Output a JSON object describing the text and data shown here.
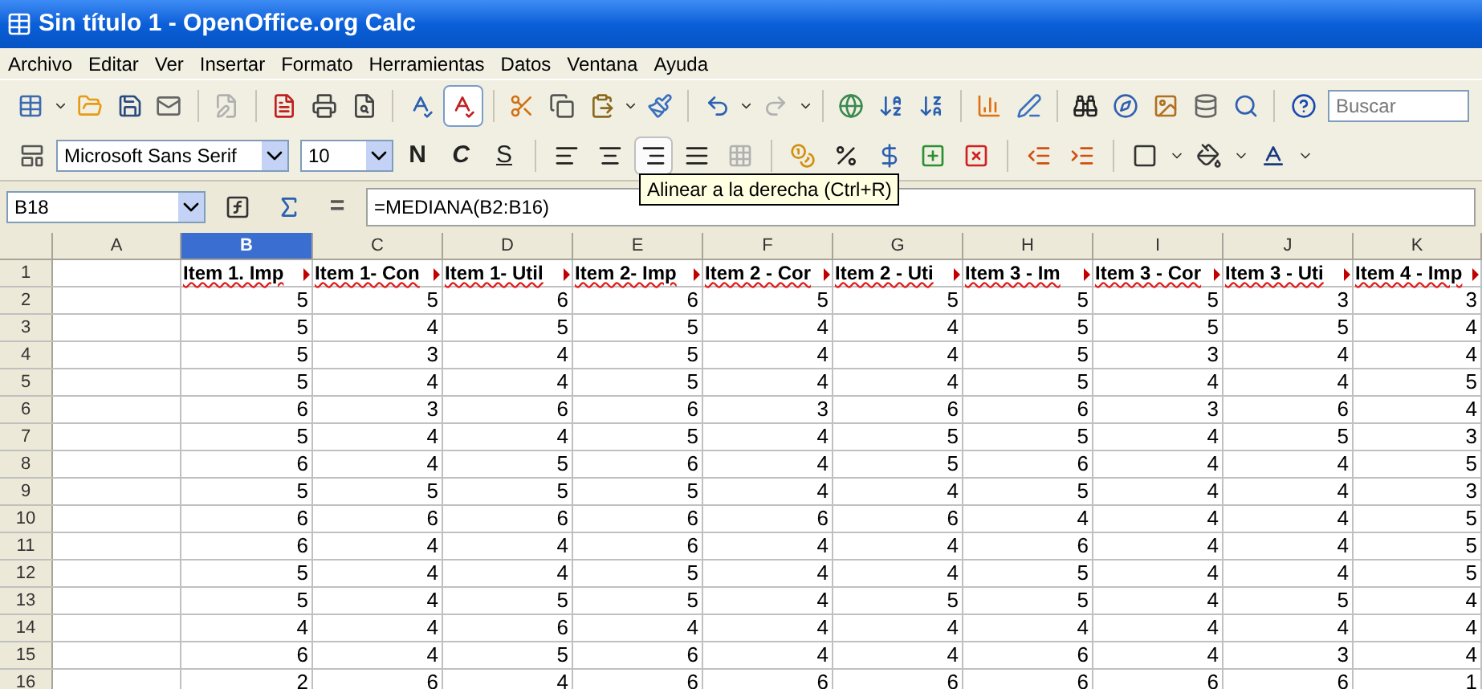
{
  "window": {
    "title": "Sin título 1 - OpenOffice.org Calc"
  },
  "menu": [
    "Archivo",
    "Editar",
    "Ver",
    "Insertar",
    "Formato",
    "Herramientas",
    "Datos",
    "Ventana",
    "Ayuda"
  ],
  "standard_toolbar": {
    "auto_spellcheck_on": true,
    "search": {
      "placeholder": "Buscar"
    }
  },
  "formatting_toolbar": {
    "font": "Microsoft Sans Serif",
    "size": "10",
    "bold": "N",
    "italic": "C",
    "underline": "S",
    "align_right_hovered": true
  },
  "tooltip": "Alinear a la derecha (Ctrl+R)",
  "formula_bar": {
    "name_box": "B18",
    "equals": "=",
    "formula": "=MEDIANA(B2:B16)"
  },
  "columns": [
    {
      "label": "A",
      "selected": false
    },
    {
      "label": "B",
      "selected": true
    },
    {
      "label": "C",
      "selected": false
    },
    {
      "label": "D",
      "selected": false
    },
    {
      "label": "E",
      "selected": false
    },
    {
      "label": "F",
      "selected": false
    },
    {
      "label": "G",
      "selected": false
    },
    {
      "label": "H",
      "selected": false
    },
    {
      "label": "I",
      "selected": false
    },
    {
      "label": "J",
      "selected": false
    },
    {
      "label": "K",
      "selected": false
    }
  ],
  "rows": [
    {
      "number": "1",
      "kind": "header",
      "cells": [
        "",
        "Item 1. Imp",
        "Item 1- Con",
        "Item 1- Util",
        "Item 2- Imp",
        "Item 2 - Cor",
        "Item 2 - Uti",
        "Item 3 - Im",
        "Item 3 - Cor",
        "Item 3 - Uti",
        "Item 4 - Imp"
      ]
    },
    {
      "number": "2",
      "kind": "data",
      "cells": [
        "",
        "5",
        "5",
        "6",
        "6",
        "5",
        "5",
        "5",
        "5",
        "3",
        "3"
      ]
    },
    {
      "number": "3",
      "kind": "data",
      "cells": [
        "",
        "5",
        "4",
        "5",
        "5",
        "4",
        "4",
        "5",
        "5",
        "5",
        "4"
      ]
    },
    {
      "number": "4",
      "kind": "data",
      "cells": [
        "",
        "5",
        "3",
        "4",
        "5",
        "4",
        "4",
        "5",
        "3",
        "4",
        "4"
      ]
    },
    {
      "number": "5",
      "kind": "data",
      "cells": [
        "",
        "5",
        "4",
        "4",
        "5",
        "4",
        "4",
        "5",
        "4",
        "4",
        "5"
      ]
    },
    {
      "number": "6",
      "kind": "data",
      "cells": [
        "",
        "6",
        "3",
        "6",
        "6",
        "3",
        "6",
        "6",
        "3",
        "6",
        "4"
      ]
    },
    {
      "number": "7",
      "kind": "data",
      "cells": [
        "",
        "5",
        "4",
        "4",
        "5",
        "4",
        "5",
        "5",
        "4",
        "5",
        "3"
      ]
    },
    {
      "number": "8",
      "kind": "data",
      "cells": [
        "",
        "6",
        "4",
        "5",
        "6",
        "4",
        "5",
        "6",
        "4",
        "4",
        "5"
      ]
    },
    {
      "number": "9",
      "kind": "data",
      "cells": [
        "",
        "5",
        "5",
        "5",
        "5",
        "4",
        "4",
        "5",
        "4",
        "4",
        "3"
      ]
    },
    {
      "number": "10",
      "kind": "data",
      "cells": [
        "",
        "6",
        "6",
        "6",
        "6",
        "6",
        "6",
        "4",
        "4",
        "4",
        "5"
      ]
    },
    {
      "number": "11",
      "kind": "data",
      "cells": [
        "",
        "6",
        "4",
        "4",
        "6",
        "4",
        "4",
        "6",
        "4",
        "4",
        "5"
      ]
    },
    {
      "number": "12",
      "kind": "data",
      "cells": [
        "",
        "5",
        "4",
        "4",
        "5",
        "4",
        "4",
        "5",
        "4",
        "4",
        "5"
      ]
    },
    {
      "number": "13",
      "kind": "data",
      "cells": [
        "",
        "5",
        "4",
        "5",
        "5",
        "4",
        "5",
        "5",
        "4",
        "5",
        "4"
      ]
    },
    {
      "number": "14",
      "kind": "data",
      "cells": [
        "",
        "4",
        "4",
        "6",
        "4",
        "4",
        "4",
        "4",
        "4",
        "4",
        "4"
      ]
    },
    {
      "number": "15",
      "kind": "data",
      "cells": [
        "",
        "6",
        "4",
        "5",
        "6",
        "4",
        "4",
        "6",
        "4",
        "3",
        "4"
      ]
    },
    {
      "number": "16",
      "kind": "data",
      "cells": [
        "",
        "2",
        "6",
        "4",
        "6",
        "6",
        "6",
        "6",
        "6",
        "6",
        "1"
      ]
    }
  ]
}
